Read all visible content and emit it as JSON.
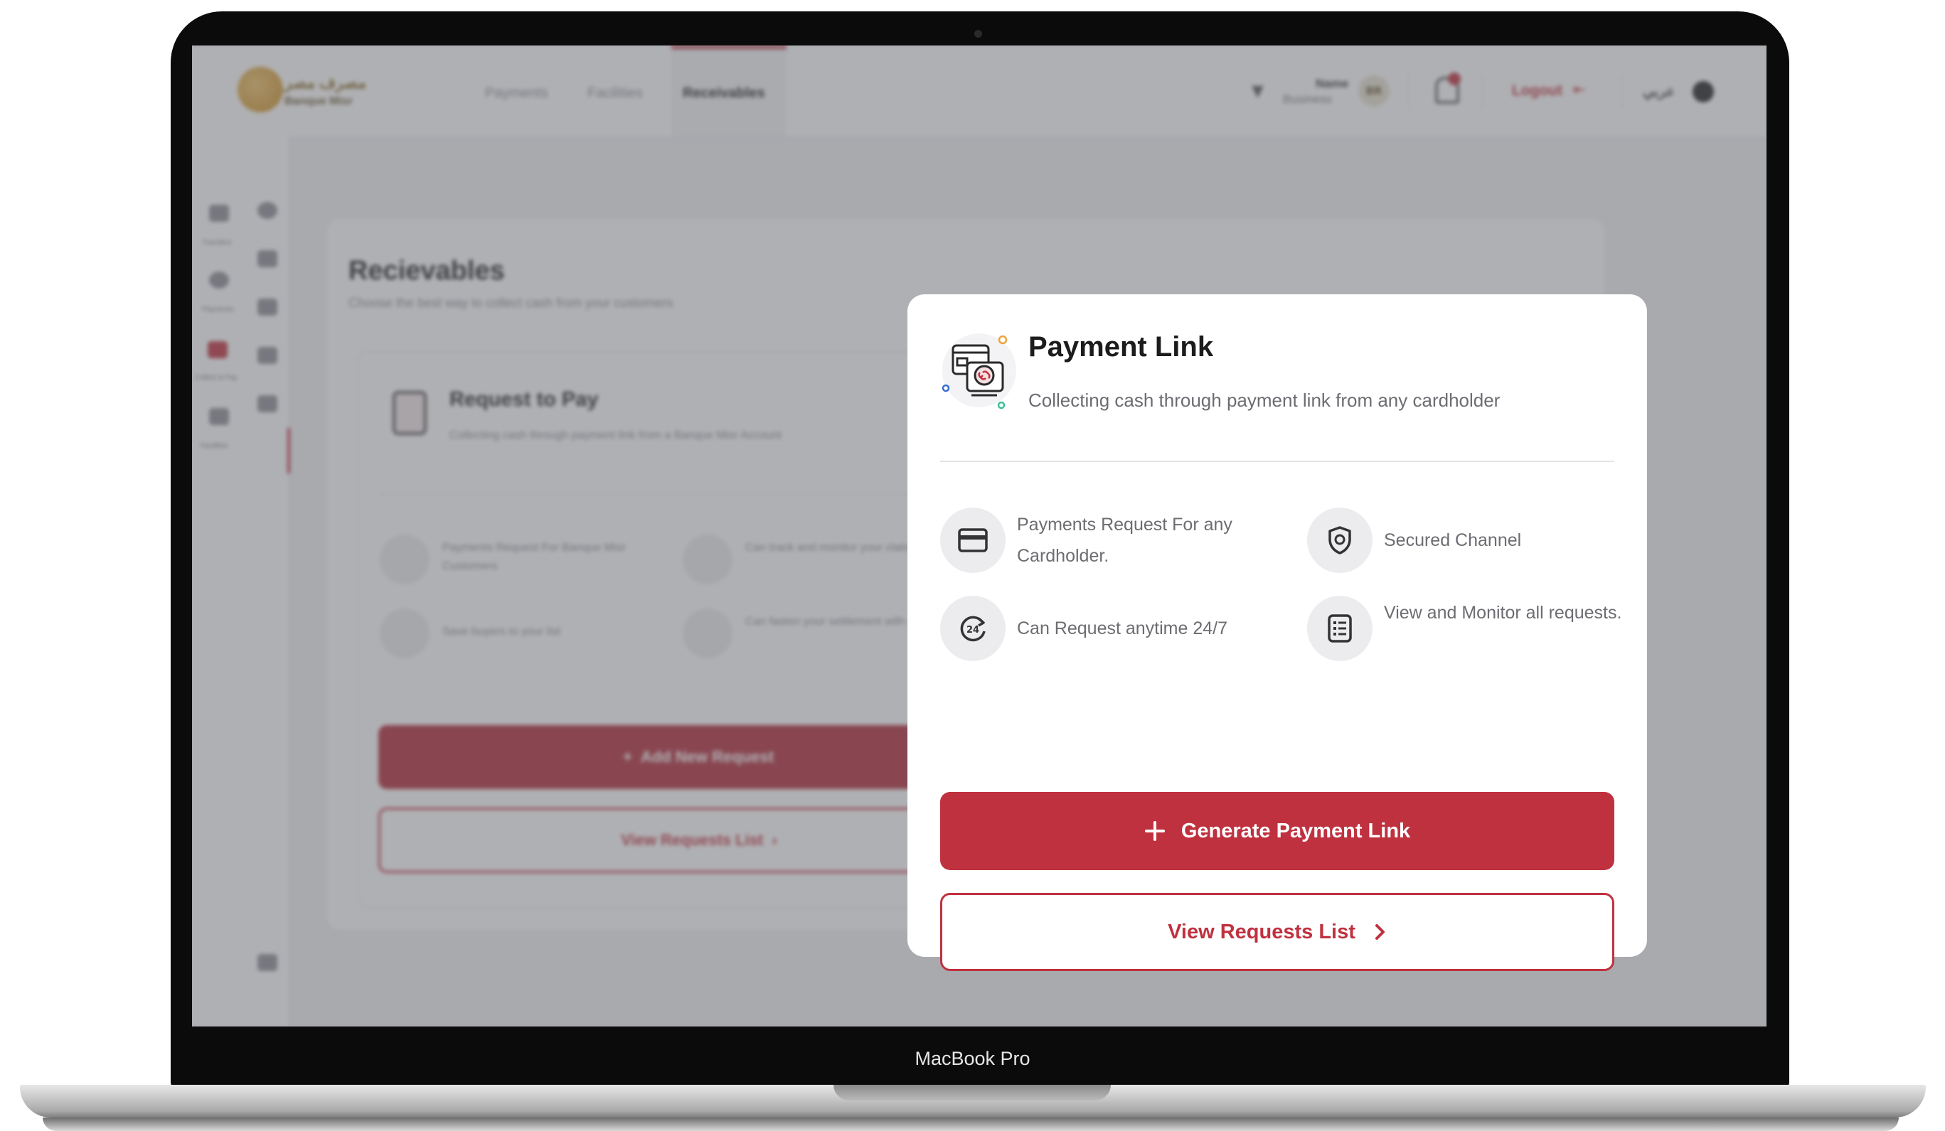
{
  "header": {
    "logo_text": "مصرف مصر",
    "logo_subtext": "Banque Misr",
    "nav": [
      "Payments",
      "Facilities",
      "Receivables"
    ],
    "active_nav": "Receivables",
    "user": {
      "name": "Name",
      "role": "Business",
      "initials": "BR"
    },
    "logout_label": "Logout",
    "language_label": "عربي"
  },
  "sidebar": {
    "items": [
      "Transfers",
      "Payments",
      "Collect & Pay",
      "Facilities"
    ]
  },
  "page": {
    "title": "Recievables",
    "subtitle": "Choose the best way to collect cash from your customers"
  },
  "request_to_pay": {
    "title": "Request to Pay",
    "subtitle": "Collecting cash through payment link from a Banque Misr Account",
    "features": [
      "Payments Request For Banque Misr Customers",
      "Can track and monitor your claims",
      "Save buyers to your list",
      "Can fasten your settlement with in partial"
    ],
    "primary_label": "Add New Request",
    "secondary_label": "View Requests List"
  },
  "modal": {
    "title": "Payment Link",
    "subtitle": "Collecting cash through payment link from any cardholder",
    "features": [
      {
        "icon": "credit-card-icon",
        "text": "Payments Request For any Cardholder."
      },
      {
        "icon": "shield-icon",
        "text": "Secured Channel"
      },
      {
        "icon": "clock-24-icon",
        "text": "Can Request anytime 24/7"
      },
      {
        "icon": "list-icon",
        "text": "View and Monitor all requests."
      }
    ],
    "primary_label": "Generate Payment Link",
    "secondary_label": "View Requests List"
  },
  "device": {
    "label": "MacBook Pro"
  },
  "colors": {
    "accent": "#c0313f",
    "overlay": "#606268",
    "text_muted": "#6c6c72"
  }
}
